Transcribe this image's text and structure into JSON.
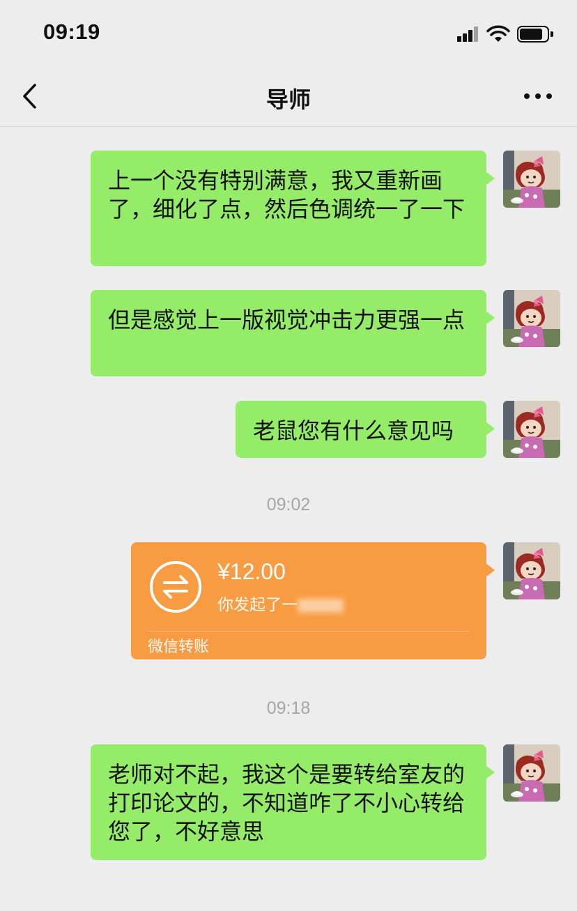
{
  "status_bar": {
    "time": "09:19",
    "battery_level": 0.85
  },
  "nav": {
    "title": "导师",
    "back_icon": "chevron-left-icon",
    "more_icon": "more-dots-icon"
  },
  "messages": [
    {
      "type": "text",
      "text": "上一个没有特别满意，我又重新画了，细化了点，然后色调统一了一下"
    },
    {
      "type": "text",
      "text": "但是感觉上一版视觉冲击力更强一点"
    },
    {
      "type": "text",
      "text": "老鼠您有什么意见吗"
    },
    {
      "type": "timestamp",
      "text": "09:02"
    },
    {
      "type": "transfer",
      "amount": "¥12.00",
      "description": "你发起了一",
      "label": "微信转账",
      "icon": "transfer-arrows-icon"
    },
    {
      "type": "timestamp",
      "text": "09:18"
    },
    {
      "type": "text",
      "text": "老师对不起，我这个是要转给室友的打印论文的，不知道咋了不小心转给您了，不好意思"
    }
  ],
  "colors": {
    "background": "#ededed",
    "bubble": "#95ec69",
    "transfer": "#f79c43"
  }
}
